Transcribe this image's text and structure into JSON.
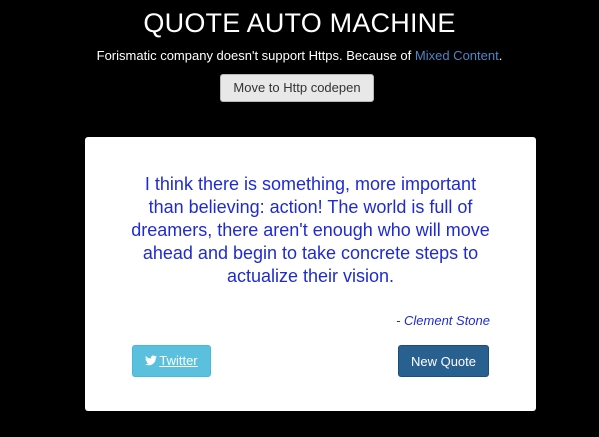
{
  "header": {
    "title": "QUOTE AUTO MACHINE",
    "notice_text": "Forismatic company doesn't support Https. Because of ",
    "notice_link": "Mixed Content",
    "notice_end": ".",
    "move_button_label": "Move to Http codepen"
  },
  "quote": {
    "text": "I think there is something, more important than believing: action! The world is full of dreamers, there aren't enough who will move ahead and begin to take concrete steps to actualize their vision.",
    "author": "- Clement Stone"
  },
  "actions": {
    "twitter_label": "Twitter",
    "twitter_icon": "twitter-bird-icon",
    "new_quote_label": "New Quote"
  },
  "colors": {
    "background": "#000000",
    "card": "#ffffff",
    "quote_text": "#1f2bd0",
    "link": "#4f86c6",
    "twitter_button": "#5bc0de",
    "new_quote_button": "#286090"
  }
}
